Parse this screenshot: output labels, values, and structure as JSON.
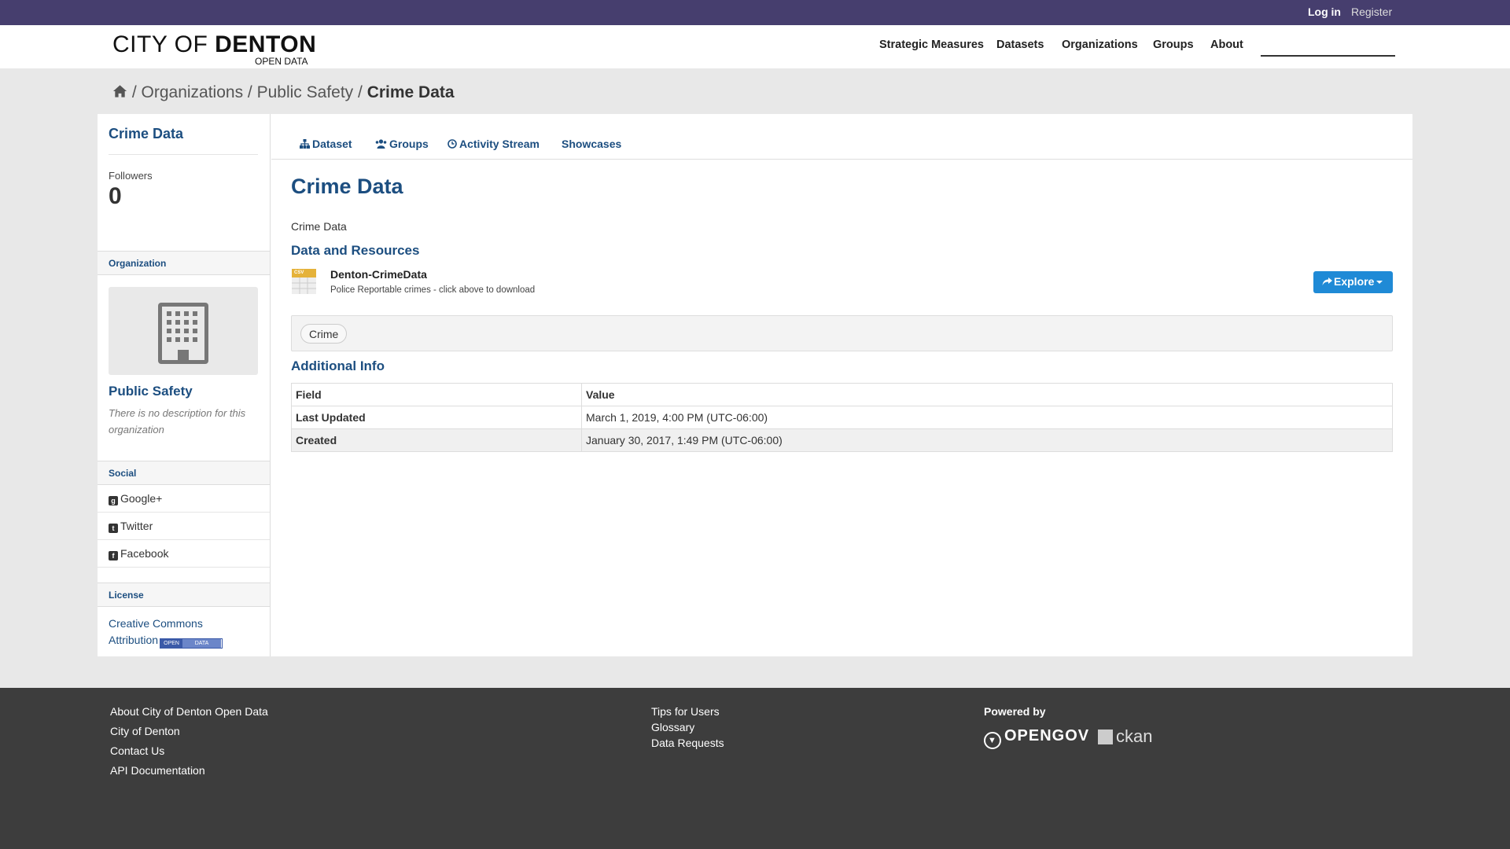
{
  "topbar": {
    "login": "Log in",
    "register": "Register"
  },
  "header": {
    "logo_main_light": "CITY OF ",
    "logo_main_bold": "DENTON",
    "logo_sub": "OPEN DATA",
    "nav": [
      "Strategic Measures",
      "Datasets",
      "Organizations",
      "Groups",
      "About"
    ]
  },
  "breadcrumb": {
    "sep": " / ",
    "items": [
      "Organizations",
      "Public Safety"
    ],
    "current": "Crime Data"
  },
  "sidebar": {
    "title": "Crime Data",
    "followers_label": "Followers",
    "followers_count": "0",
    "organization_heading": "Organization",
    "org_name": "Public Safety",
    "org_desc": "There is no description for this organization",
    "social_heading": "Social",
    "social": [
      "Google+",
      "Twitter",
      "Facebook"
    ],
    "license_heading": "License",
    "license_line1": "Creative Commons",
    "license_line2": "Attribution",
    "badge_left": "OPEN",
    "badge_right": "DATA"
  },
  "tabs": [
    "Dataset",
    "Groups",
    "Activity Stream",
    "Showcases"
  ],
  "main": {
    "title": "Crime Data",
    "description": "Crime Data",
    "resources_heading": "Data and Resources",
    "resource": {
      "badge": "CSV",
      "name": "Denton-CrimeData",
      "desc": "Police Reportable crimes - click above to download"
    },
    "explore_label": "Explore",
    "tag": "Crime",
    "info_heading": "Additional Info",
    "table": {
      "headers": [
        "Field",
        "Value"
      ],
      "rows": [
        [
          "Last Updated",
          "March 1, 2019, 4:00 PM (UTC-06:00)"
        ],
        [
          "Created",
          "January 30, 2017, 1:49 PM (UTC-06:00)"
        ]
      ]
    }
  },
  "footer": {
    "col1": [
      "About City of Denton Open Data",
      "City of Denton",
      "Contact Us",
      "API Documentation"
    ],
    "col2": [
      "Tips for Users",
      "Glossary",
      "Data Requests"
    ],
    "powered_by": "Powered by",
    "opengov": "OPENGOV",
    "ckan": "ckan"
  },
  "colors": {
    "topbar": "#463e6e",
    "link": "#1c4e80",
    "explore": "#1f8ad6",
    "footer": "#3d3d3d"
  }
}
